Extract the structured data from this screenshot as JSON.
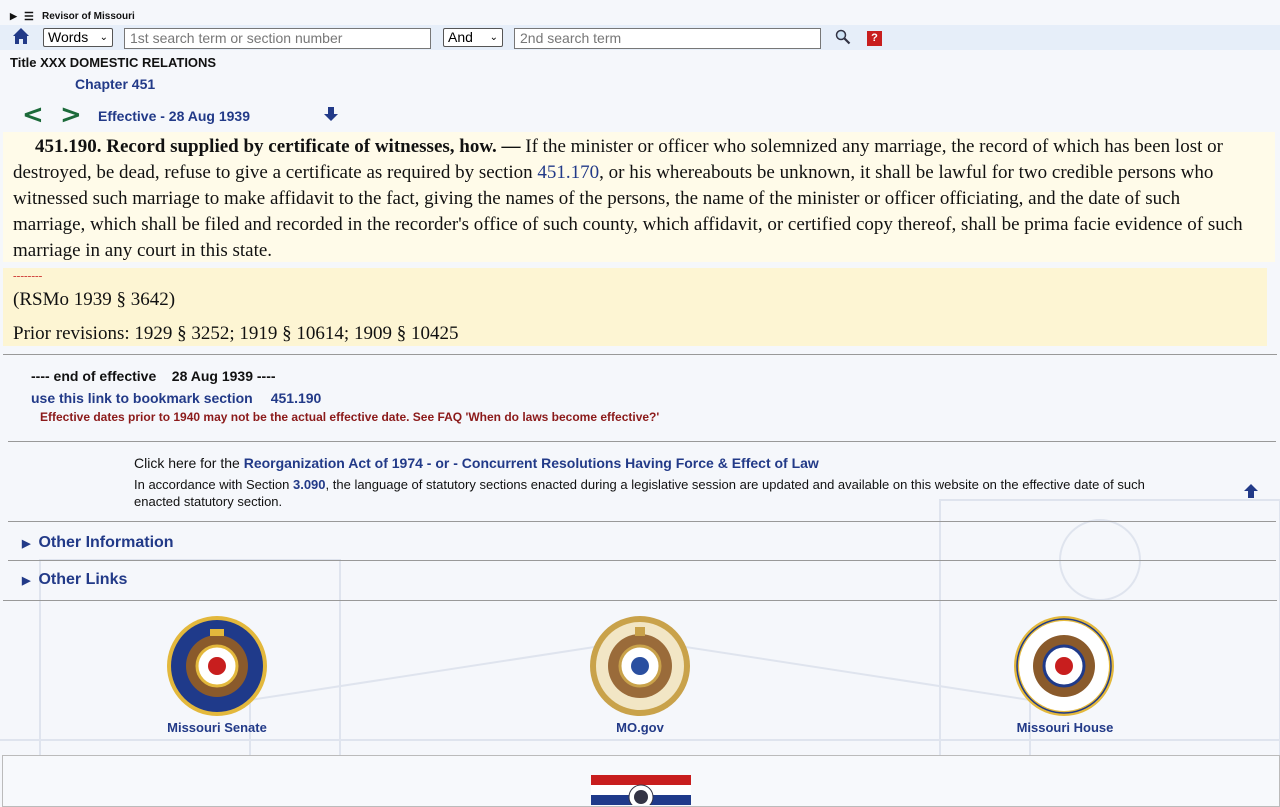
{
  "app": {
    "brand": "Revisor of Missouri"
  },
  "search": {
    "mode_value": "Words",
    "mode_options": [
      "Words"
    ],
    "term1_placeholder": "1st search term or section number",
    "op_value": "And",
    "term2_placeholder": "2nd search term",
    "help_label": "?"
  },
  "header": {
    "title_line": "Title XXX DOMESTIC RELATIONS",
    "chapter": "Chapter 451",
    "prev": "<",
    "next": ">",
    "effective": "Effective - 28 Aug 1939"
  },
  "section": {
    "number": "451.190.",
    "heading": "Record supplied by certificate of witnesses, how. —",
    "text_before_link": " If the minister or officer who solemnized any marriage, the record of which has been lost or destroyed, be dead, refuse to give a certificate as required by section ",
    "link": "451.170",
    "text_after_link": ", or his whereabouts be unknown, it shall be lawful for two credible persons who witnessed such marriage to make affidavit to the fact, giving the names of the persons, the name of the minister or officer officiating, and the date of such marriage, which shall be filed and recorded in the recorder's office of such county, which affidavit, or certified copy thereof, shall be prima facie evidence of such marriage in any court in this state."
  },
  "history": {
    "dashes": "--------",
    "rsmo": "(RSMo 1939 § 3642)",
    "prior": "Prior revisions: 1929 § 3252; 1919 § 10614; 1909 § 10425"
  },
  "footer_info": {
    "end_effective": "---- end of effective    28 Aug 1939 ----",
    "bookmark_label": "use this link to bookmark section",
    "bookmark_section": "451.190",
    "warning": "Effective dates prior to 1940 may not be the actual effective date. See FAQ 'When do laws become effective?'"
  },
  "reorg": {
    "prefix": "Click here for the ",
    "link": "Reorganization Act of 1974 - or - Concurrent Resolutions Having Force & Effect of Law",
    "accord_prefix": "In accordance with Section ",
    "accord_link": "3.090",
    "accord_rest": ", the language of statutory sections enacted during a legislative session are updated and available on this website on the effective date of such enacted statutory section."
  },
  "disclosures": [
    {
      "label": "Other Information"
    },
    {
      "label": "Other Links"
    }
  ],
  "seals": [
    {
      "label": "Missouri Senate",
      "icon": "senate-seal-icon"
    },
    {
      "label": "MO.gov",
      "icon": "state-seal-icon"
    },
    {
      "label": "Missouri House",
      "icon": "house-seal-icon"
    }
  ],
  "colors": {
    "link": "#223a88",
    "section_bg": "#fffbe9",
    "history_bg": "#fdf5d3",
    "warning": "#8b1a1a",
    "nav_arrows": "#1c6a3a"
  }
}
